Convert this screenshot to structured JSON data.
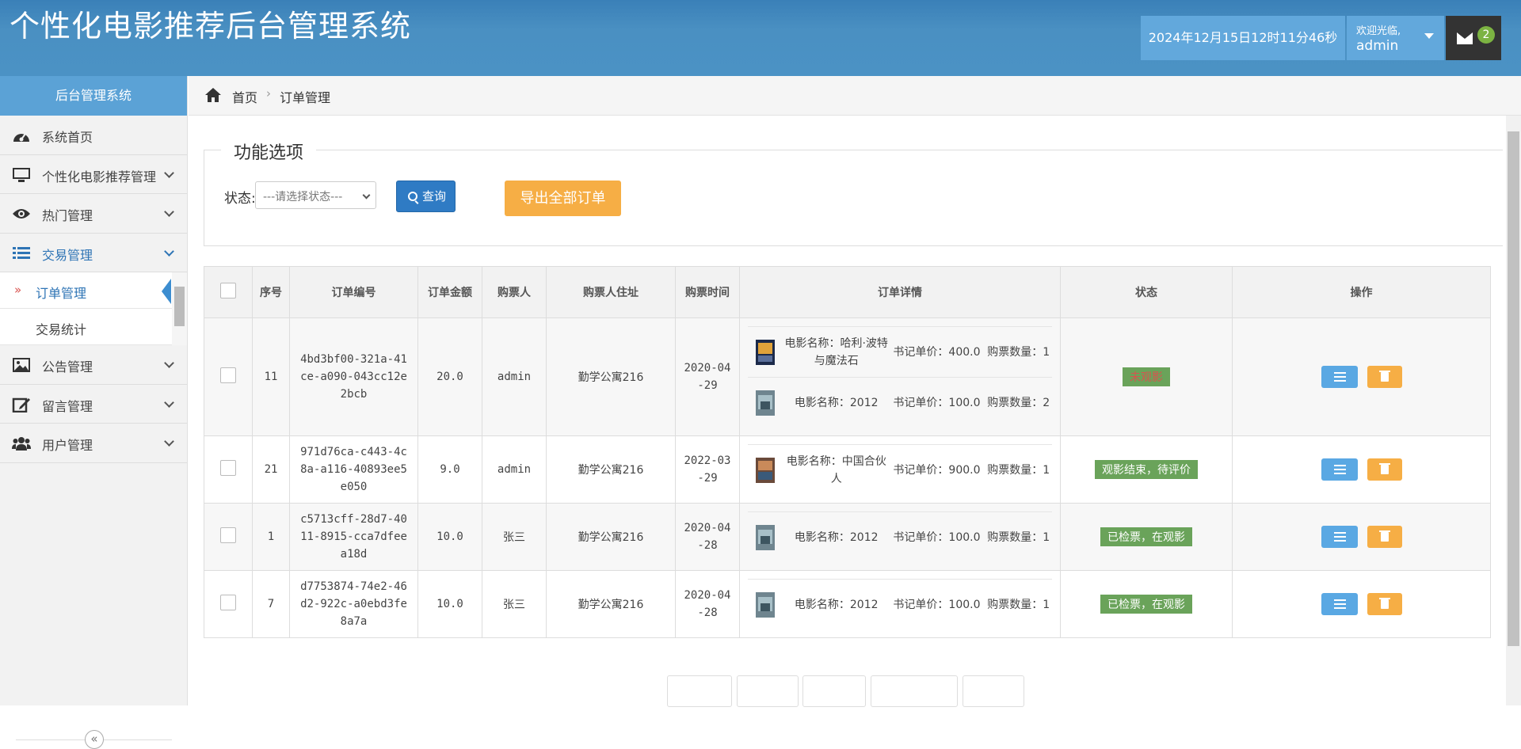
{
  "header": {
    "title": "个性化电影推荐后台管理系统",
    "datetime": "2024年12月15日12时11分46秒",
    "welcome": "欢迎光临,",
    "username": "admin",
    "message_count": "2"
  },
  "sidebar": {
    "header": "后台管理系统",
    "items": [
      {
        "label": "系统首页",
        "icon": "dashboard-icon"
      },
      {
        "label": "个性化电影推荐管理",
        "icon": "monitor-icon"
      },
      {
        "label": "热门管理",
        "icon": "eye-icon"
      },
      {
        "label": "交易管理",
        "icon": "list-icon"
      },
      {
        "label": "公告管理",
        "icon": "image-icon"
      },
      {
        "label": "留言管理",
        "icon": "edit-icon"
      },
      {
        "label": "用户管理",
        "icon": "users-icon"
      }
    ],
    "subitems": [
      {
        "label": "订单管理"
      },
      {
        "label": "交易统计"
      }
    ],
    "collapse": "«"
  },
  "breadcrumb": {
    "home": "首页",
    "current": "订单管理"
  },
  "filter": {
    "legend": "功能选项",
    "status_label": "状态:",
    "status_placeholder": "---请选择状态---",
    "query_button": "查询",
    "export_button": "导出全部订单"
  },
  "table": {
    "headers": [
      "序号",
      "订单编号",
      "订单金额",
      "购票人",
      "购票人住址",
      "购票时间",
      "订单详情",
      "状态",
      "操作"
    ],
    "rows": [
      {
        "id": "11",
        "order_no": "4bd3bf00-321a-41ce-a090-043cc12e2bcb",
        "amount": "20.0",
        "buyer": "admin",
        "address": "勤学公寓216",
        "date": "2020-04-29",
        "status": "未观影",
        "movies": [
          {
            "name": "电影名称：哈利·波特与魔法石",
            "price": "书记单价：400.0",
            "qty": "购票数量：1"
          },
          {
            "name": "电影名称：2012",
            "price": "书记单价：100.0",
            "qty": "购票数量：2"
          }
        ]
      },
      {
        "id": "21",
        "order_no": "971d76ca-c443-4c8a-a116-40893ee5e050",
        "amount": "9.0",
        "buyer": "admin",
        "address": "勤学公寓216",
        "date": "2022-03-29",
        "status": "观影结束，待评价",
        "movies": [
          {
            "name": "电影名称：中国合伙人",
            "price": "书记单价：900.0",
            "qty": "购票数量：1"
          }
        ]
      },
      {
        "id": "1",
        "order_no": "c5713cff-28d7-4011-8915-cca7dfeea18d",
        "amount": "10.0",
        "buyer": "张三",
        "address": "勤学公寓216",
        "date": "2020-04-28",
        "status": "已检票，在观影",
        "movies": [
          {
            "name": "电影名称：2012",
            "price": "书记单价：100.0",
            "qty": "购票数量：1"
          }
        ]
      },
      {
        "id": "7",
        "order_no": "d7753874-74e2-46d2-922c-a0ebd3fe8a7a",
        "amount": "10.0",
        "buyer": "张三",
        "address": "勤学公寓216",
        "date": "2020-04-28",
        "status": "已检票，在观影",
        "movies": [
          {
            "name": "电影名称：2012",
            "price": "书记单价：100.0",
            "qty": "购票数量：1"
          }
        ]
      }
    ]
  },
  "colors": {
    "header": "#4a90c2",
    "sidebar_active": "#2e74b5",
    "export": "#f6ae45",
    "query": "#2f7bc4",
    "badge": "#6aa35a"
  }
}
